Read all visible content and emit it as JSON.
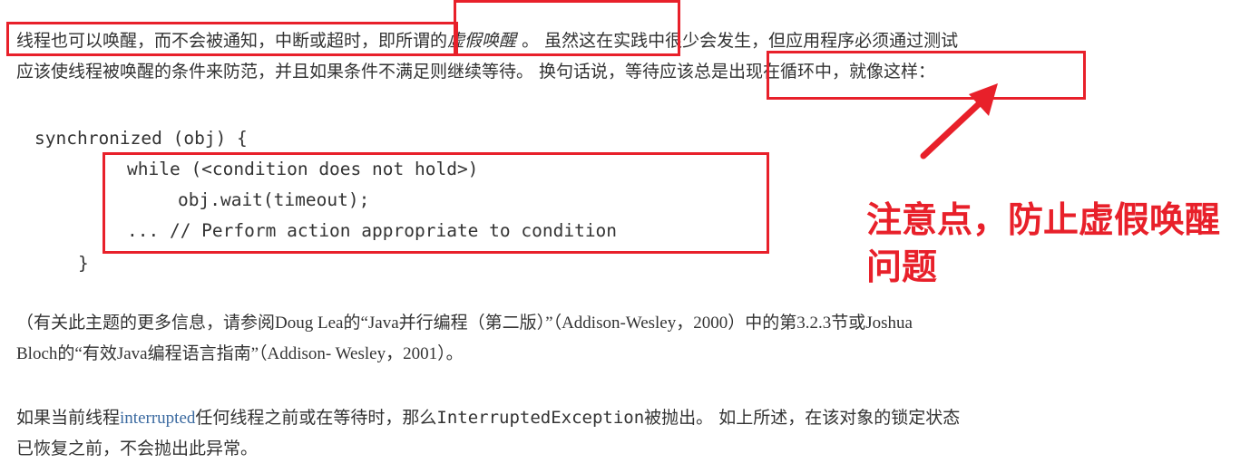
{
  "para1": {
    "line1_a": "线程也可以唤醒，而不会被通知，中断或超时",
    "line1_b": "，即所谓的",
    "spurious": "虚假唤醒",
    "line1_c": " 。 虽然这在实践中很少会发生，但应用程序必须通过测试",
    "line2": "应该使线程被唤醒的条件来防范，并且如果条件不满足则继续等待。 换句话说，等待应该总是出现在循环中，就像这样："
  },
  "code": {
    "line1": "synchronized (obj) {",
    "line2": "while (<condition does not hold>)",
    "line3": "obj.wait(timeout);",
    "line4": "... // Perform action appropriate to condition",
    "line5": "}"
  },
  "annotation": {
    "line1": "注意点，防止虚假唤醒",
    "line2": "问题",
    "color": "#e8202a"
  },
  "para2": {
    "line1": "（有关此主题的更多信息，请参阅Doug Lea的“Java并行编程（第二版）”（Addison-Wesley，2000）中的第3.2.3节或Joshua",
    "line2": "Bloch的“有效Java编程语言指南”（Addison- Wesley，2001）。"
  },
  "para3": {
    "line1_a": "如果当前线程",
    "link": "interrupted",
    "line1_b": "任何线程之前或在等待时，那么",
    "exception": "InterruptedException",
    "line1_c": "被抛出。 如上所述，在该对象的锁定状态",
    "line2": "已恢复之前，不会抛出此异常。"
  }
}
